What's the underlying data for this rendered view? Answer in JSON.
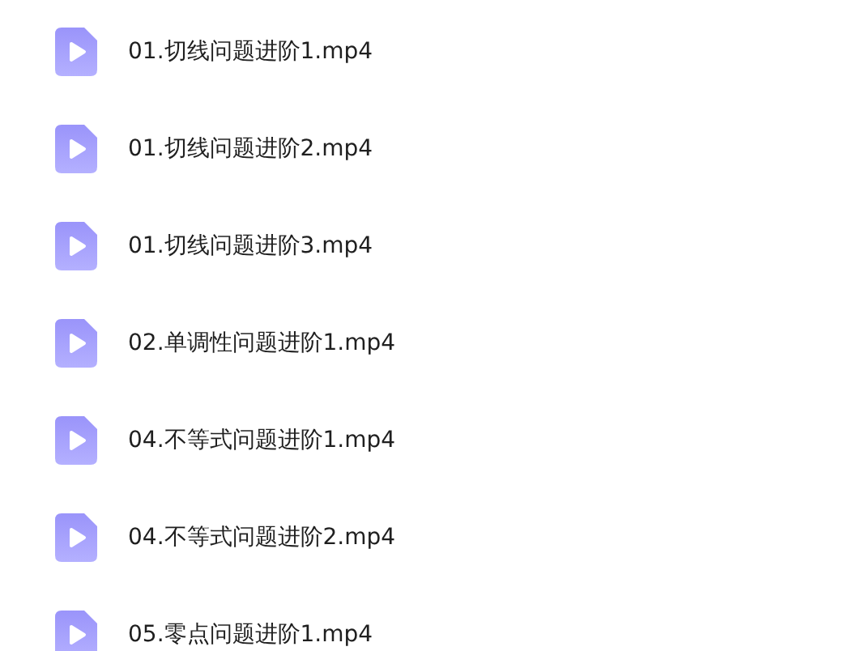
{
  "files": [
    {
      "name": "01.切线问题进阶1.mp4"
    },
    {
      "name": "01.切线问题进阶2.mp4"
    },
    {
      "name": "01.切线问题进阶3.mp4"
    },
    {
      "name": "02.单调性问题进阶1.mp4"
    },
    {
      "name": "04.不等式问题进阶1.mp4"
    },
    {
      "name": "04.不等式问题进阶2.mp4"
    },
    {
      "name": "05.零点问题进阶1.mp4"
    }
  ]
}
